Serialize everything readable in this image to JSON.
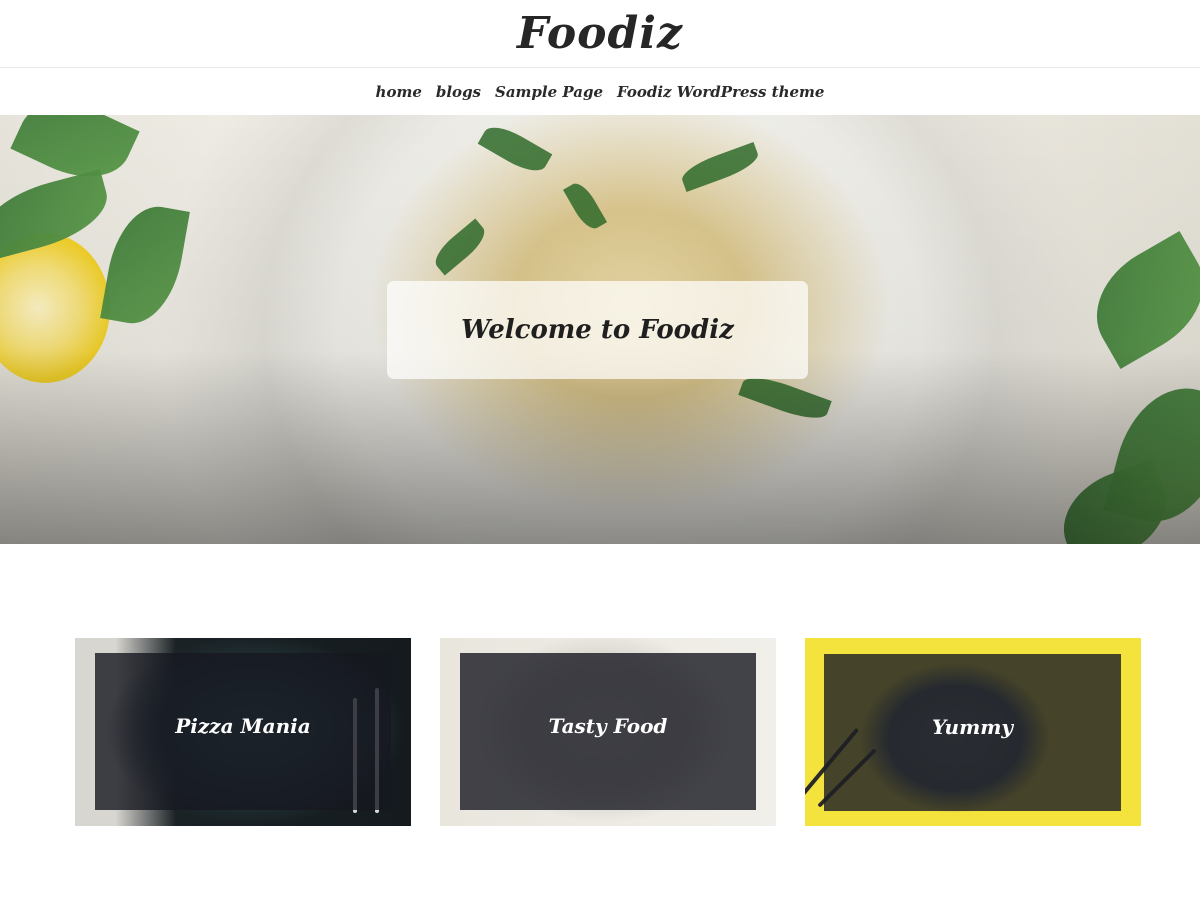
{
  "site": {
    "title": "Foodiz"
  },
  "nav": {
    "items": [
      {
        "label": "home"
      },
      {
        "label": "blogs"
      },
      {
        "label": "Sample Page"
      },
      {
        "label": "Foodiz WordPress theme"
      }
    ]
  },
  "hero": {
    "title": "Welcome to Foodiz"
  },
  "cards": [
    {
      "title": "Pizza Mania"
    },
    {
      "title": "Tasty Food"
    },
    {
      "title": "Yummy"
    }
  ],
  "colors": {
    "text": "#222222",
    "card_overlay": "#16181f",
    "accent_yellow": "#f4e23d"
  }
}
